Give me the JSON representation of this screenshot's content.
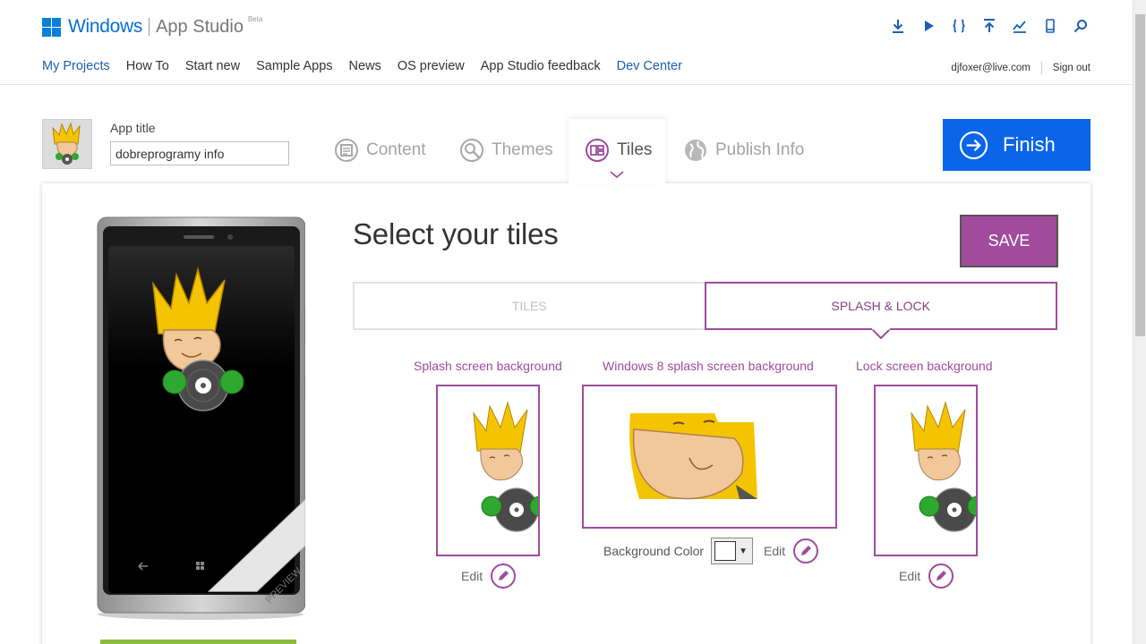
{
  "logo": {
    "windows": "Windows",
    "studio": "App Studio",
    "beta": "Beta"
  },
  "top_icons": [
    "download-icon",
    "play-icon",
    "braces-icon",
    "upload-icon",
    "chart-icon",
    "phone-icon",
    "search-icon"
  ],
  "nav": [
    {
      "label": "My Projects"
    },
    {
      "label": "How To"
    },
    {
      "label": "Start new"
    },
    {
      "label": "Sample Apps"
    },
    {
      "label": "News"
    },
    {
      "label": "OS preview"
    },
    {
      "label": "App Studio feedback"
    },
    {
      "label": "Dev Center"
    }
  ],
  "user": {
    "email": "djfoxer@live.com",
    "signout": "Sign out"
  },
  "app": {
    "title_label": "App title",
    "title_value": "dobreprogramy info"
  },
  "steps": [
    {
      "label": "Content"
    },
    {
      "label": "Themes"
    },
    {
      "label": "Tiles"
    },
    {
      "label": "Publish Info"
    }
  ],
  "finish_label": "Finish",
  "main": {
    "heading": "Select your tiles",
    "save_label": "SAVE",
    "tabs": [
      {
        "label": "TILES"
      },
      {
        "label": "SPLASH & LOCK"
      }
    ],
    "columns": {
      "splash": {
        "label": "Splash screen background",
        "edit": "Edit"
      },
      "win8": {
        "label": "Windows 8 splash screen background",
        "edit": "Edit",
        "bg_color_label": "Background Color",
        "bg_color": "#ffffff"
      },
      "lock": {
        "label": "Lock screen background",
        "edit": "Edit"
      }
    },
    "phone_badge": "PREVIEW"
  },
  "colors": {
    "accent": "#a04b9c",
    "finish": "#0a65e8",
    "link": "#1a5fb4"
  }
}
